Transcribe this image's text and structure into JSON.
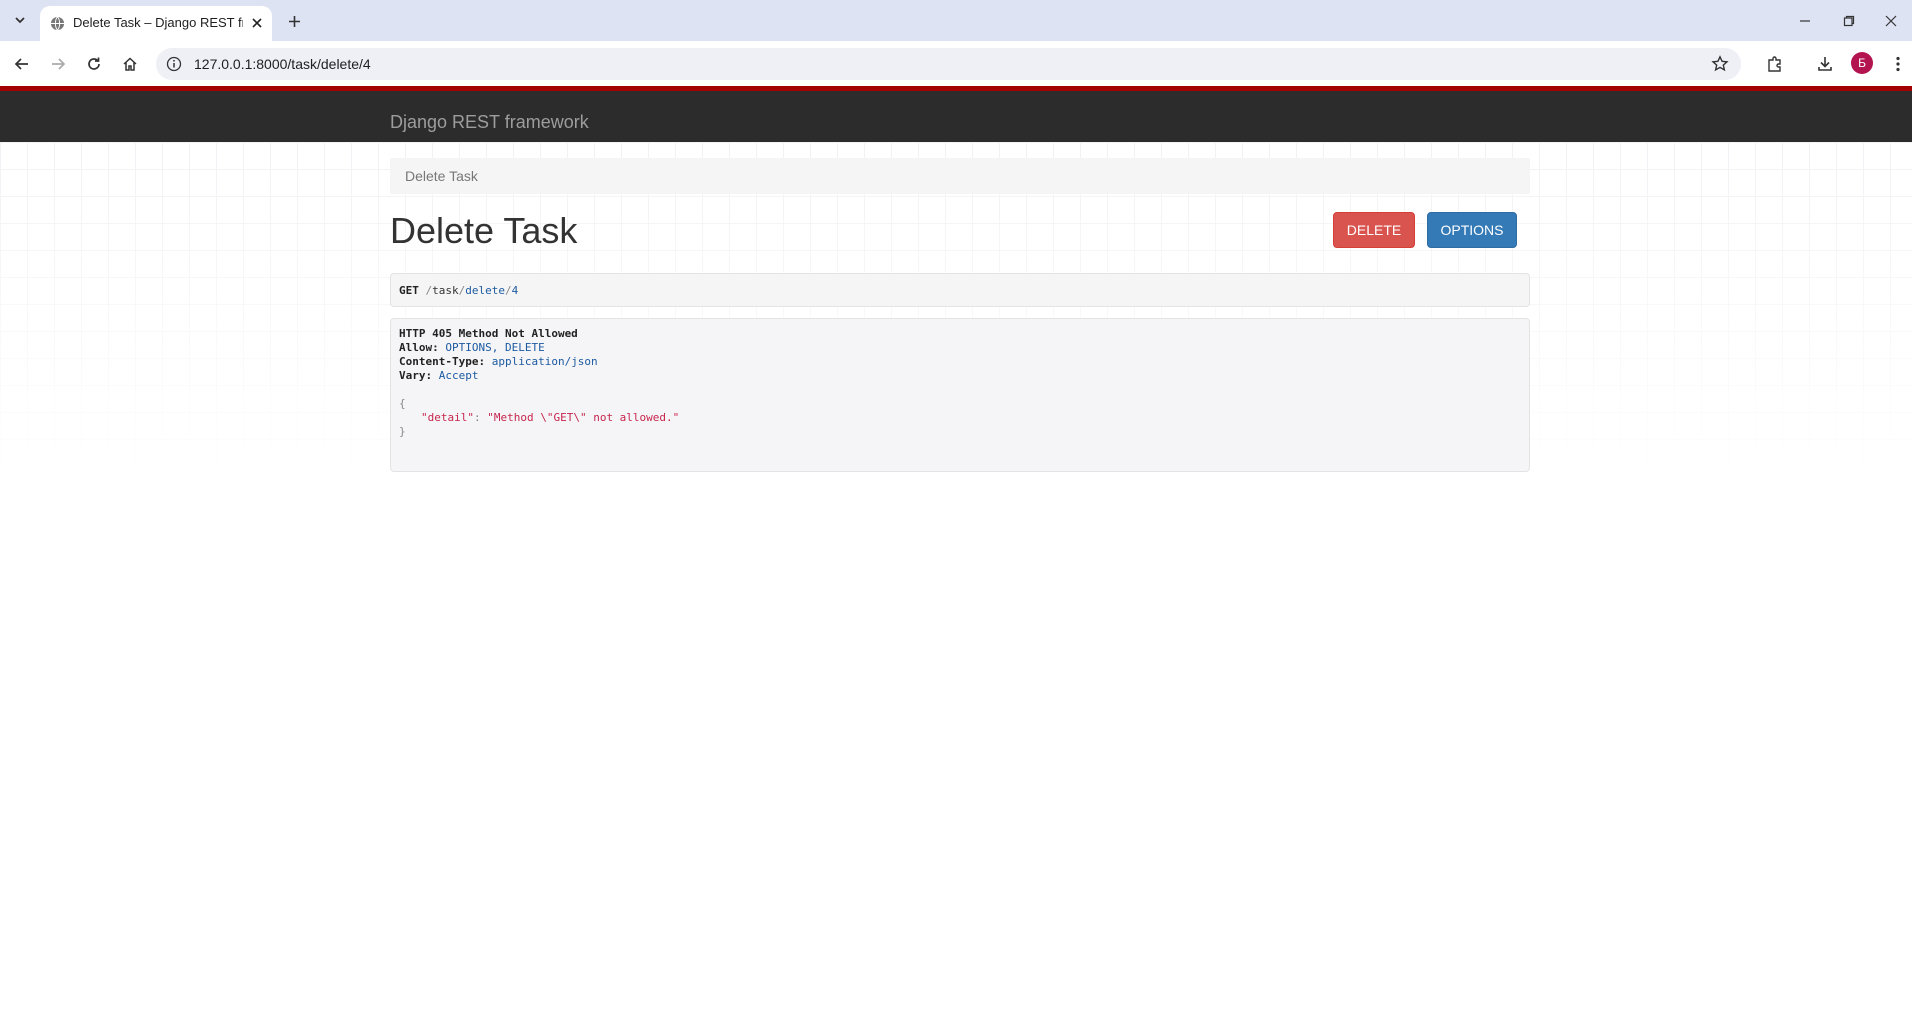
{
  "browser": {
    "tab_title": "Delete Task – Django REST fram",
    "url": "127.0.0.1:8000/task/delete/4",
    "profile_initial": "Б"
  },
  "navbar": {
    "brand": "Django REST framework"
  },
  "breadcrumb": {
    "item": "Delete Task"
  },
  "page": {
    "title": "Delete Task",
    "delete_label": "DELETE",
    "options_label": "OPTIONS"
  },
  "request": {
    "method": "GET",
    "path_parts": [
      "/",
      "task",
      "/",
      "delete",
      "/",
      "4"
    ]
  },
  "response": {
    "status": "HTTP 405 Method Not Allowed",
    "headers": [
      {
        "name": "Allow:",
        "value": "OPTIONS, DELETE"
      },
      {
        "name": "Content-Type:",
        "value": "application/json"
      },
      {
        "name": "Vary:",
        "value": "Accept"
      }
    ],
    "open_brace": "{",
    "body_key": "\"detail\"",
    "body_sep": ": ",
    "body_value": "\"Method \\\"GET\\\" not allowed.\"",
    "close_brace": "}"
  },
  "colors": {
    "navbar_bg": "#2c2c2c",
    "navbar_accent": "#a30000",
    "delete_btn": "#d9534f",
    "options_btn": "#337ab7"
  }
}
